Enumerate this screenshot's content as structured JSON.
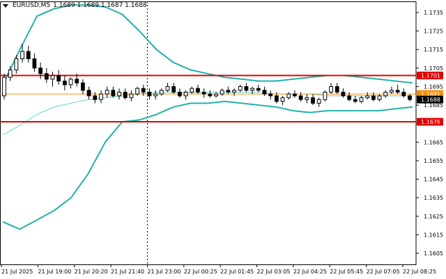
{
  "header": {
    "symbol": "EURUSD,M5",
    "ohlc": "1.1689 1.1689 1.1687 1.1688"
  },
  "colors": {
    "bands": "#20b2aa",
    "middle_band": "#3fc9c1",
    "support_resistance": "#e00000",
    "last_price": "#000000",
    "orange_line": "#ff8c00",
    "grid": "#000000"
  },
  "chart_data": {
    "type": "candlestick",
    "title": "",
    "xlabel": "",
    "ylabel": "",
    "ylim": [
      1.1599,
      1.1741
    ],
    "y_ticks": [
      "1.1735",
      "1.1725",
      "1.1715",
      "1.1705",
      "1.1695",
      "1.1685",
      "1.1675",
      "1.1665",
      "1.1655",
      "1.1645",
      "1.1635",
      "1.1625",
      "1.1615",
      "1.1605"
    ],
    "x_ticks": [
      "21 Jul 2025",
      "21 Jul 19:00",
      "21 Jul 20:20",
      "21 Jul 21:40",
      "21 Jul 23:00",
      "22 Jul 00:25",
      "22 Jul 01:45",
      "22 Jul 03:05",
      "22 Jul 04:25",
      "22 Jul 05:45",
      "22 Jul 07:05",
      "22 Jul 08:25"
    ],
    "grid": "off",
    "vertical_marker_at": "21 Jul 23:00",
    "horizontal_levels": [
      {
        "label": "1.1701",
        "value": 1.1701,
        "style": "red-thick"
      },
      {
        "label": "1.1691",
        "value": 1.1691,
        "style": "orange-thin"
      },
      {
        "label": "1.1688",
        "value": 1.1688,
        "style": "last-price"
      },
      {
        "label": "1.1676",
        "value": 1.1676,
        "style": "red-thick"
      }
    ],
    "upper_band": [
      1.1696,
      1.1715,
      1.1733,
      1.1737,
      1.1739,
      1.1739,
      1.1738,
      1.1734,
      1.1725,
      1.1715,
      1.1708,
      1.1704,
      1.1702,
      1.17,
      1.1699,
      1.1698,
      1.1698,
      1.1699,
      1.17,
      1.1701,
      1.1701,
      1.17,
      1.1699,
      1.1698,
      1.1697
    ],
    "middle_band": [
      1.1669,
      1.1674,
      1.168,
      1.1684,
      1.1686,
      1.1688,
      1.1689,
      1.169,
      1.1691,
      1.1692,
      1.1692,
      1.1692,
      1.1692,
      1.1692,
      1.1692,
      1.1692,
      1.1691,
      1.1691,
      1.1691,
      1.169,
      1.169,
      1.169,
      1.169,
      1.169,
      1.169
    ],
    "lower_band": [
      1.1622,
      1.1618,
      1.1623,
      1.1628,
      1.1635,
      1.1648,
      1.1665,
      1.1676,
      1.1677,
      1.168,
      1.1684,
      1.1686,
      1.1686,
      1.1687,
      1.1686,
      1.1685,
      1.1684,
      1.1682,
      1.1681,
      1.1682,
      1.1682,
      1.1682,
      1.1682,
      1.1683,
      1.1684
    ],
    "candles": [
      [
        1.169,
        1.1702,
        1.1688,
        1.17
      ],
      [
        1.17,
        1.1706,
        1.1698,
        1.1704
      ],
      [
        1.1704,
        1.1712,
        1.1702,
        1.171
      ],
      [
        1.171,
        1.1718,
        1.1708,
        1.1714
      ],
      [
        1.1714,
        1.1717,
        1.1708,
        1.171
      ],
      [
        1.171,
        1.1713,
        1.1703,
        1.1705
      ],
      [
        1.1705,
        1.1708,
        1.1699,
        1.1702
      ],
      [
        1.1702,
        1.1705,
        1.1697,
        1.1699
      ],
      [
        1.1699,
        1.1703,
        1.1695,
        1.1701
      ],
      [
        1.1701,
        1.1704,
        1.1696,
        1.1698
      ],
      [
        1.1698,
        1.1701,
        1.1693,
        1.1696
      ],
      [
        1.1696,
        1.17,
        1.1694,
        1.1699
      ],
      [
        1.1699,
        1.1702,
        1.1695,
        1.1697
      ],
      [
        1.1697,
        1.1699,
        1.1691,
        1.1693
      ],
      [
        1.1693,
        1.1695,
        1.1688,
        1.169
      ],
      [
        1.169,
        1.1692,
        1.1686,
        1.1688
      ],
      [
        1.1688,
        1.1693,
        1.1686,
        1.1691
      ],
      [
        1.1691,
        1.1695,
        1.1689,
        1.1693
      ],
      [
        1.1693,
        1.1695,
        1.1689,
        1.169
      ],
      [
        1.169,
        1.1694,
        1.1688,
        1.1692
      ],
      [
        1.1692,
        1.1694,
        1.1688,
        1.1689
      ],
      [
        1.1689,
        1.1693,
        1.1687,
        1.1691
      ],
      [
        1.1691,
        1.1695,
        1.169,
        1.1694
      ],
      [
        1.1694,
        1.1696,
        1.169,
        1.1692
      ],
      [
        1.1692,
        1.1694,
        1.1688,
        1.169
      ],
      [
        1.169,
        1.1693,
        1.1688,
        1.1691
      ],
      [
        1.1691,
        1.1694,
        1.169,
        1.1693
      ],
      [
        1.1693,
        1.1697,
        1.1692,
        1.1695
      ],
      [
        1.1695,
        1.1697,
        1.1691,
        1.1692
      ],
      [
        1.1692,
        1.1694,
        1.1689,
        1.169
      ],
      [
        1.169,
        1.1693,
        1.1688,
        1.1692
      ],
      [
        1.1692,
        1.1695,
        1.1691,
        1.1694
      ],
      [
        1.1694,
        1.1696,
        1.1691,
        1.1692
      ],
      [
        1.1692,
        1.1694,
        1.1689,
        1.1691
      ],
      [
        1.1691,
        1.1693,
        1.1689,
        1.169
      ],
      [
        1.169,
        1.1692,
        1.1689,
        1.1691
      ],
      [
        1.1691,
        1.1694,
        1.169,
        1.1693
      ],
      [
        1.1693,
        1.1695,
        1.1691,
        1.1692
      ],
      [
        1.1692,
        1.1694,
        1.169,
        1.1693
      ],
      [
        1.1693,
        1.1696,
        1.1692,
        1.1695
      ],
      [
        1.1695,
        1.1697,
        1.1692,
        1.1693
      ],
      [
        1.1693,
        1.1695,
        1.1691,
        1.1694
      ],
      [
        1.1694,
        1.1696,
        1.1692,
        1.1693
      ],
      [
        1.1693,
        1.1695,
        1.169,
        1.1691
      ],
      [
        1.1691,
        1.1693,
        1.1688,
        1.169
      ],
      [
        1.169,
        1.1692,
        1.1686,
        1.1687
      ],
      [
        1.1687,
        1.169,
        1.1685,
        1.1689
      ],
      [
        1.1689,
        1.1692,
        1.1688,
        1.1691
      ],
      [
        1.1691,
        1.1693,
        1.1689,
        1.169
      ],
      [
        1.169,
        1.1692,
        1.1687,
        1.1688
      ],
      [
        1.1688,
        1.1691,
        1.1686,
        1.1689
      ],
      [
        1.1689,
        1.1691,
        1.1685,
        1.1686
      ],
      [
        1.1686,
        1.1689,
        1.1684,
        1.1688
      ],
      [
        1.1688,
        1.1693,
        1.1687,
        1.1692
      ],
      [
        1.1692,
        1.1697,
        1.1691,
        1.1695
      ],
      [
        1.1695,
        1.1697,
        1.1691,
        1.1692
      ],
      [
        1.1692,
        1.1694,
        1.1689,
        1.169
      ],
      [
        1.169,
        1.1692,
        1.1687,
        1.1688
      ],
      [
        1.1688,
        1.169,
        1.1686,
        1.1687
      ],
      [
        1.1687,
        1.169,
        1.1686,
        1.1689
      ],
      [
        1.1689,
        1.1692,
        1.1688,
        1.169
      ],
      [
        1.169,
        1.1692,
        1.1687,
        1.1688
      ],
      [
        1.1688,
        1.1691,
        1.1687,
        1.169
      ],
      [
        1.169,
        1.1693,
        1.1689,
        1.1692
      ],
      [
        1.1692,
        1.1695,
        1.1691,
        1.1693
      ],
      [
        1.1693,
        1.1696,
        1.1691,
        1.1692
      ],
      [
        1.1692,
        1.1694,
        1.1689,
        1.169
      ],
      [
        1.169,
        1.1691,
        1.1687,
        1.1688
      ]
    ]
  }
}
